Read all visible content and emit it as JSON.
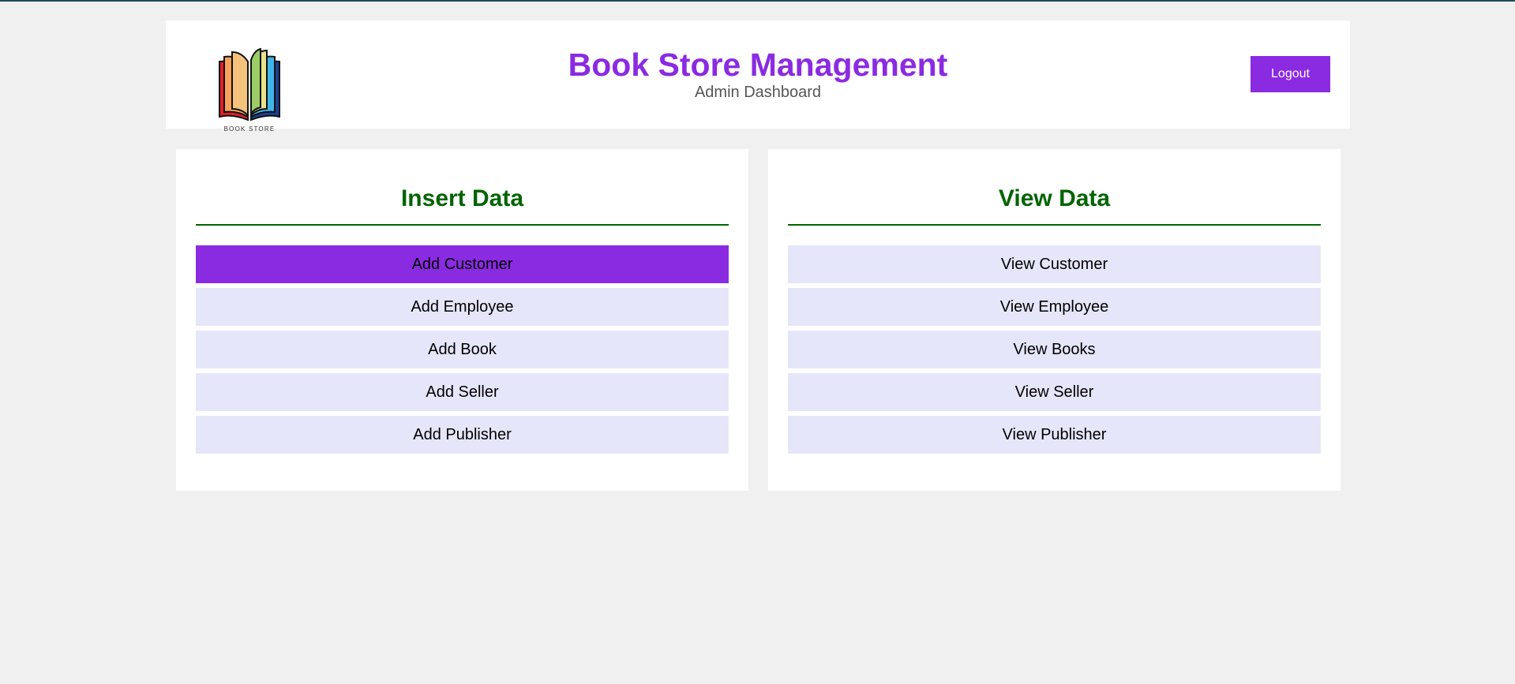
{
  "header": {
    "title": "Book Store Management",
    "subtitle": "Admin Dashboard",
    "logo_caption": "BOOK STORE",
    "logout_label": "Logout"
  },
  "insert_panel": {
    "heading": "Insert Data",
    "items": [
      {
        "label": "Add Customer",
        "active": true
      },
      {
        "label": "Add Employee",
        "active": false
      },
      {
        "label": "Add Book",
        "active": false
      },
      {
        "label": "Add Seller",
        "active": false
      },
      {
        "label": "Add Publisher",
        "active": false
      }
    ]
  },
  "view_panel": {
    "heading": "View Data",
    "items": [
      {
        "label": "View Customer",
        "active": false
      },
      {
        "label": "View Employee",
        "active": false
      },
      {
        "label": "View Books",
        "active": false
      },
      {
        "label": "View Seller",
        "active": false
      },
      {
        "label": "View Publisher",
        "active": false
      }
    ]
  },
  "colors": {
    "accent": "#8a2be2",
    "heading": "#006400",
    "button_bg": "#e6e6fa",
    "page_bg": "#f0f0f0"
  },
  "icons": {
    "logo": "open-book-icon"
  }
}
